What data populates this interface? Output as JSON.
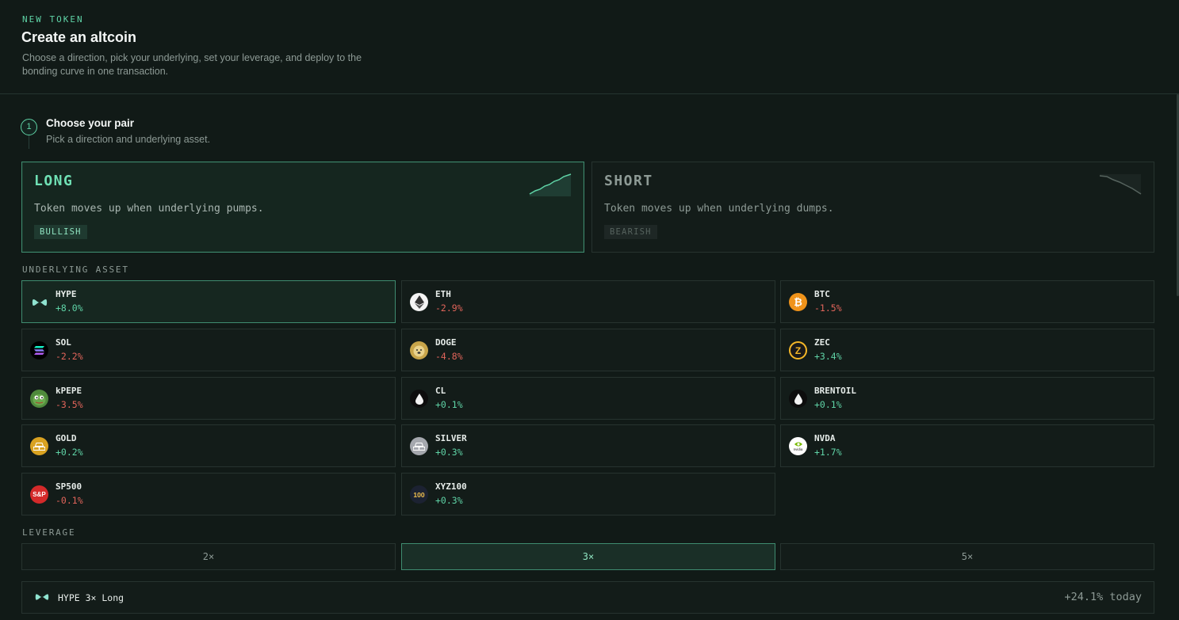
{
  "header": {
    "eyebrow": "NEW TOKEN",
    "title": "Create an altcoin",
    "subtitle": "Choose a direction, pick your underlying, set your leverage, and deploy to the bonding curve in one transaction."
  },
  "step": {
    "number": "1",
    "title": "Choose your pair",
    "subtitle": "Pick a direction and underlying asset."
  },
  "directions": [
    {
      "title": "LONG",
      "description": "Token moves up when underlying pumps.",
      "badge": "BULLISH",
      "selected": true
    },
    {
      "title": "SHORT",
      "description": "Token moves up when underlying dumps.",
      "badge": "BEARISH",
      "selected": false
    }
  ],
  "assets_label": "UNDERLYING ASSET",
  "assets": [
    {
      "name": "HYPE",
      "change": "+8.0%",
      "icon": "hype-icon",
      "selected": true
    },
    {
      "name": "ETH",
      "change": "-2.9%",
      "icon": "eth-icon"
    },
    {
      "name": "BTC",
      "change": "-1.5%",
      "icon": "btc-icon"
    },
    {
      "name": "SOL",
      "change": "-2.2%",
      "icon": "sol-icon"
    },
    {
      "name": "DOGE",
      "change": "-4.8%",
      "icon": "doge-icon"
    },
    {
      "name": "ZEC",
      "change": "+3.4%",
      "icon": "zec-icon"
    },
    {
      "name": "kPEPE",
      "change": "-3.5%",
      "icon": "pepe-icon"
    },
    {
      "name": "CL",
      "change": "+0.1%",
      "icon": "oil-drop-icon"
    },
    {
      "name": "BRENTOIL",
      "change": "+0.1%",
      "icon": "oil-drop-icon"
    },
    {
      "name": "GOLD",
      "change": "+0.2%",
      "icon": "gold-bars-icon"
    },
    {
      "name": "SILVER",
      "change": "+0.3%",
      "icon": "silver-bars-icon"
    },
    {
      "name": "NVDA",
      "change": "+1.7%",
      "icon": "nvidia-icon"
    },
    {
      "name": "SP500",
      "change": "-0.1%",
      "icon": "sp500-icon"
    },
    {
      "name": "XYZ100",
      "change": "+0.3%",
      "icon": "xyz100-icon"
    }
  ],
  "icon_text": {
    "btc": "₿",
    "zec": "Z",
    "sp500": "S&P",
    "xyz100": "100",
    "nvda": "nvidia"
  },
  "leverage_label": "LEVERAGE",
  "leverage": [
    {
      "label": "2×",
      "selected": false
    },
    {
      "label": "3×",
      "selected": true
    },
    {
      "label": "5×",
      "selected": false
    }
  ],
  "summary": {
    "label": "HYPE 3× Long",
    "change": "+24.1% today"
  },
  "colors": {
    "accent": "#5fd3a6",
    "negative": "#e0645a",
    "background": "#111a17"
  }
}
